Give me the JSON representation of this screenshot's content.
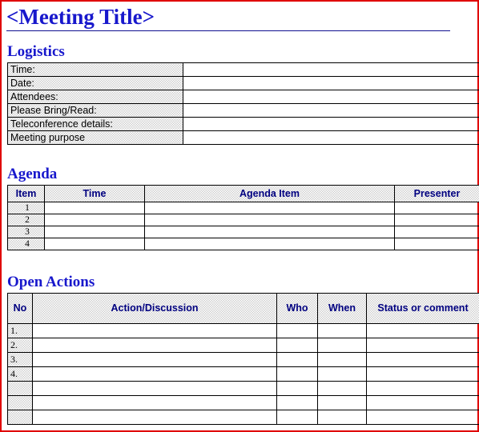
{
  "document": {
    "title": "<Meeting Title>"
  },
  "sections": {
    "logistics": {
      "heading": "Logistics",
      "rows": [
        {
          "label": "Time:",
          "value": ""
        },
        {
          "label": "Date:",
          "value": ""
        },
        {
          "label": "Attendees:",
          "value": ""
        },
        {
          "label": "Please Bring/Read:",
          "value": ""
        },
        {
          "label": "Teleconference details:",
          "value": ""
        },
        {
          "label": "Meeting purpose",
          "value": ""
        }
      ]
    },
    "agenda": {
      "heading": "Agenda",
      "columns": [
        "Item",
        "Time",
        "Agenda Item",
        "Presenter"
      ],
      "rows": [
        {
          "item": "1",
          "time": "",
          "agenda_item": "",
          "presenter": ""
        },
        {
          "item": "2",
          "time": "",
          "agenda_item": "",
          "presenter": ""
        },
        {
          "item": "3",
          "time": "",
          "agenda_item": "",
          "presenter": ""
        },
        {
          "item": "4",
          "time": "",
          "agenda_item": "",
          "presenter": ""
        }
      ]
    },
    "open_actions": {
      "heading": "Open Actions",
      "columns": [
        "No",
        "Action/Discussion",
        "Who",
        "When",
        "Status or comment"
      ],
      "rows": [
        {
          "no": "1.",
          "action": "",
          "who": "",
          "when": "",
          "status": ""
        },
        {
          "no": "2.",
          "action": "",
          "who": "",
          "when": "",
          "status": ""
        },
        {
          "no": "3.",
          "action": "",
          "who": "",
          "when": "",
          "status": ""
        },
        {
          "no": "4.",
          "action": "",
          "who": "",
          "when": "",
          "status": ""
        },
        {
          "no": "",
          "action": "",
          "who": "",
          "when": "",
          "status": ""
        },
        {
          "no": "",
          "action": "",
          "who": "",
          "when": "",
          "status": ""
        },
        {
          "no": "",
          "action": "",
          "who": "",
          "when": "",
          "status": ""
        }
      ]
    }
  },
  "colors": {
    "page_border": "#e00000",
    "heading_blue": "#1818cc",
    "table_header_navy": "#000080",
    "shading_grey": "#d0d0d0",
    "rule_navy": "#101090"
  }
}
